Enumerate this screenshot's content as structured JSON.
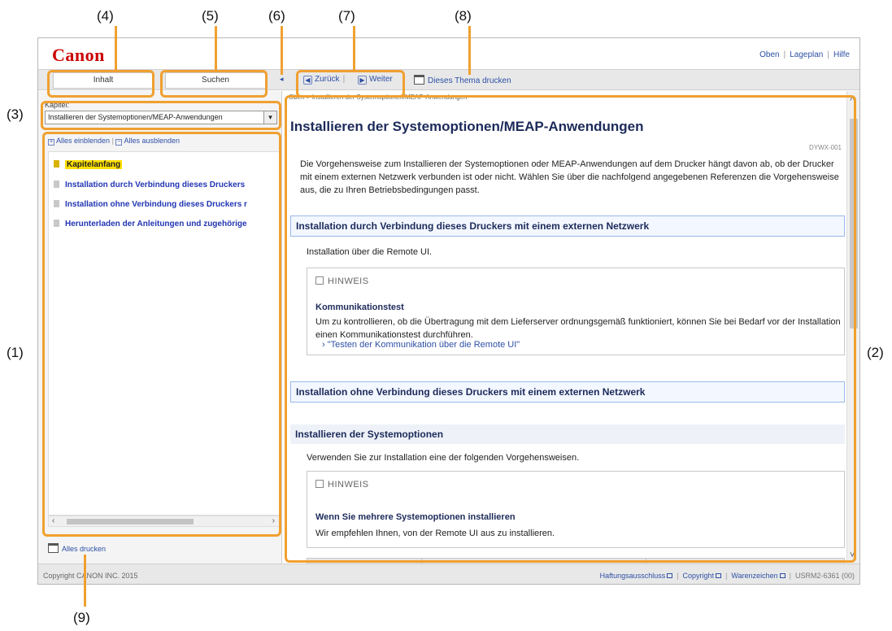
{
  "callouts": {
    "c1": "(1)",
    "c2": "(2)",
    "c3": "(3)",
    "c4": "(4)",
    "c5": "(5)",
    "c6": "(6)",
    "c7": "(7)",
    "c8": "(8)",
    "c9": "(9)"
  },
  "header": {
    "logo": "Canon",
    "links": [
      "Oben",
      "Lageplan",
      "Hilfe"
    ]
  },
  "tabs": {
    "contents": "Inhalt",
    "search": "Suchen",
    "collapse_icon": "◂"
  },
  "nav": {
    "back": "Zurück",
    "forward": "Weiter",
    "print_topic": "Dieses Thema drucken"
  },
  "sidebar": {
    "chapter_label": "Kapitel:",
    "chapter_value": "Installieren der Systemoptionen/MEAP-Anwendungen",
    "expand_all": "Alles einblenden",
    "collapse_all": "Alles ausblenden",
    "items": [
      {
        "label": "Kapitelanfang"
      },
      {
        "label": "Installation durch Verbindung dieses Druckers"
      },
      {
        "label": "Installation ohne Verbindung dieses Druckers r"
      },
      {
        "label": "Herunterladen der Anleitungen und zugehörige"
      }
    ],
    "print_all": "Alles drucken"
  },
  "main": {
    "breadcrumb": "Oben > Installieren der Systemoptionen/MEAP-Anwendungen",
    "title": "Installieren der Systemoptionen/MEAP-Anwendungen",
    "doc_id": "DYWX-001",
    "intro": "Die Vorgehensweise zum Installieren der Systemoptionen oder MEAP-Anwendungen auf dem Drucker hängt davon ab, ob der Drucker mit einem externen Netzwerk verbunden ist oder nicht. Wählen Sie über die nachfolgend angegebenen Referenzen die Vorgehensweise aus, die zu Ihren Betriebsbedingungen passt.",
    "section1": {
      "heading": "Installation durch Verbindung dieses Druckers mit einem externen Netzwerk",
      "text": "Installation über die Remote UI.",
      "note_label": "HINWEIS",
      "note_title": "Kommunikationstest",
      "note_body": "Um zu kontrollieren, ob die Übertragung mit dem Lieferserver ordnungsgemäß funktioniert, können Sie bei Bedarf vor der Installation einen Kommunikationstest durchführen.",
      "note_link": "\"Testen der Kommunikation über die Remote UI\""
    },
    "section2": {
      "heading": "Installation ohne Verbindung dieses Druckers mit einem externen Netzwerk",
      "subheading": "Installieren der Systemoptionen",
      "text": "Verwenden Sie zur Installation eine der folgenden Vorgehensweisen.",
      "note_label": "HINWEIS",
      "note_title": "Wenn Sie mehrere Systemoptionen installieren",
      "note_body": "Wir empfehlen Ihnen, von der Remote UI aus zu installieren."
    }
  },
  "footer": {
    "copyright": "Copyright CANON INC. 2015",
    "links": [
      "Haftungsausschluss",
      "Copyright",
      "Warenzeichen"
    ],
    "code": "USRM2-6361 (00)"
  },
  "colors": {
    "accent_callout": "#f0a030",
    "brand": "#cc0000",
    "link": "#2d4fa5",
    "heading": "#1c2a5a",
    "highlight": "#ffe000"
  }
}
